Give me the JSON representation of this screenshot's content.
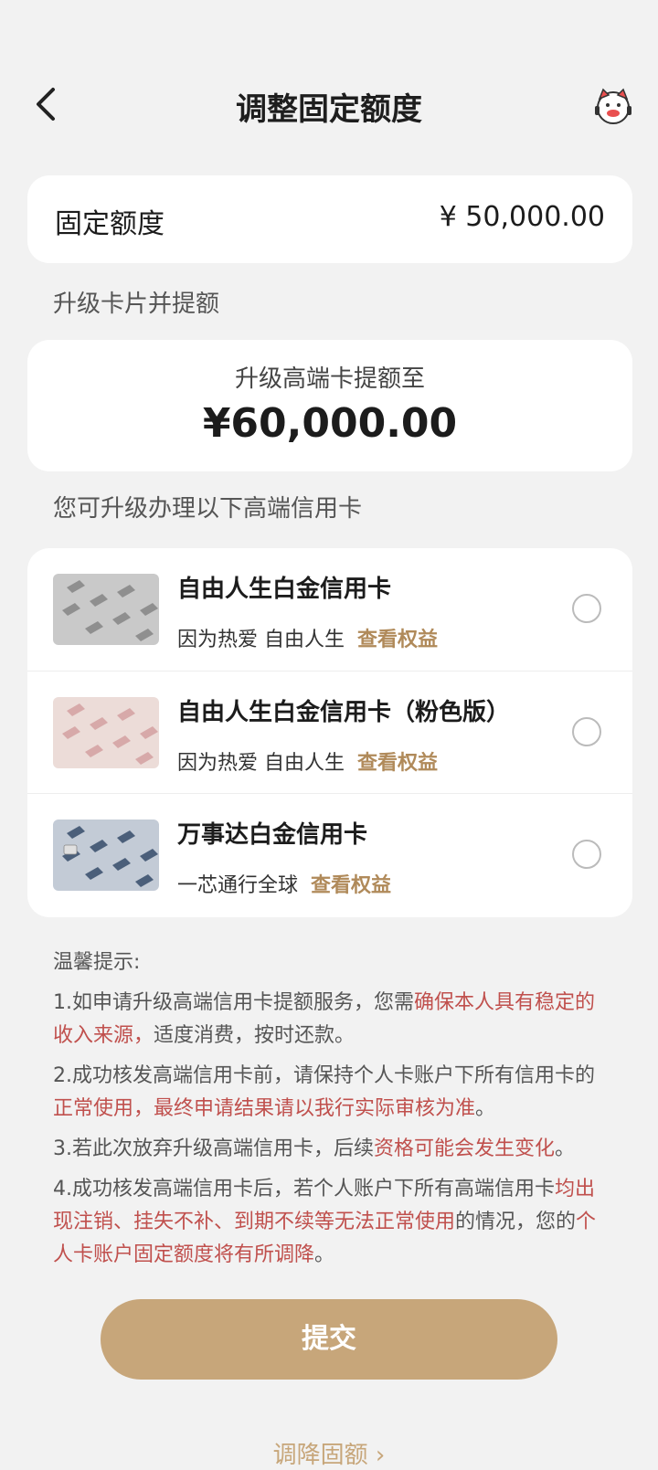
{
  "header": {
    "title": "调整固定额度"
  },
  "fixed": {
    "label": "固定额度",
    "value": "¥ 50,000.00"
  },
  "upgrade_section": {
    "title": "升级卡片并提额"
  },
  "upgrade": {
    "subtitle": "升级高端卡提额至",
    "amount": "¥60,000.00"
  },
  "cards_section": {
    "title": "您可升级办理以下高端信用卡"
  },
  "cards": [
    {
      "name": "自由人生白金信用卡",
      "desc": "因为热爱 自由人生",
      "link": "查看权益"
    },
    {
      "name": "自由人生白金信用卡（粉色版）",
      "desc": "因为热爱 自由人生",
      "link": "查看权益"
    },
    {
      "name": "万事达白金信用卡",
      "desc": "一芯通行全球",
      "link": "查看权益"
    }
  ],
  "tips": {
    "title": "温馨提示:",
    "t1_a": "1.如申请升级高端信用卡提额服务，您需",
    "t1_b": "确保本人具有稳定的收入来源，",
    "t1_c": "适度消费，按时还款。",
    "t2_a": "2.成功核发高端信用卡前，请保持个人卡账户下所有信用卡的",
    "t2_b": "正常使用，最终申请结果请以我行实际审核为准",
    "t2_c": "。",
    "t3_a": "3.若此次放弃升级高端信用卡，后续",
    "t3_b": "资格可能会发生变化",
    "t3_c": "。",
    "t4_a": "4.成功核发高端信用卡后，若个人账户下所有高端信用卡",
    "t4_b": "均出现注销、挂失不补、到期不续等无法正常使用",
    "t4_c": "的情况，您的",
    "t4_d": "个人卡账户固定额度将有所调降",
    "t4_e": "。"
  },
  "submit_label": "提交",
  "lower_link": "调降固额 ›",
  "colors": {
    "accent": "#c7a67a",
    "link": "#b08a5a",
    "warning": "#c0504d"
  }
}
